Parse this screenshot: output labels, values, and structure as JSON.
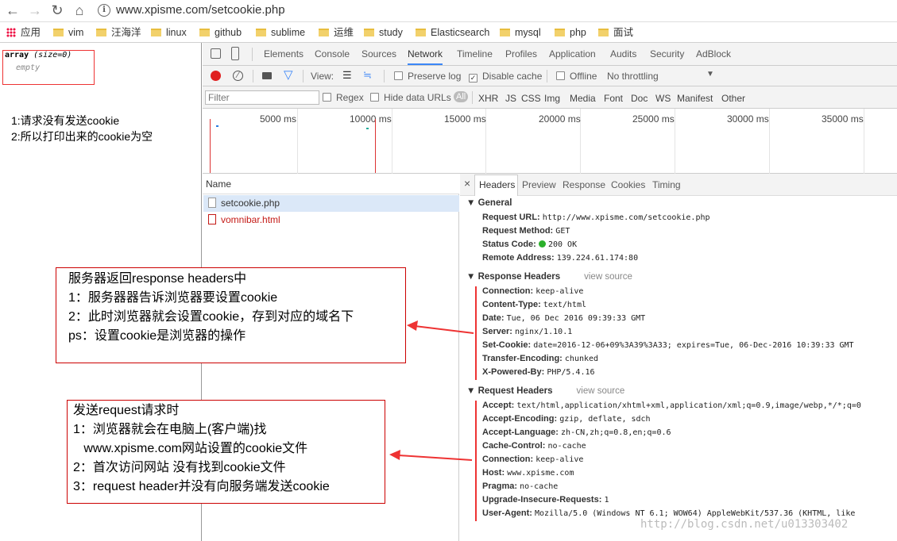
{
  "browser": {
    "url": "www.xpisme.com/setcookie.php",
    "bookmarks": [
      "应用",
      "vim",
      "汪海洋",
      "linux",
      "github",
      "sublime",
      "运维",
      "study",
      "Elasticsearch",
      "mysql",
      "php",
      "面试"
    ]
  },
  "page": {
    "var_dump_type": "array",
    "var_dump_size": "(size=0)",
    "var_dump_empty": "empty",
    "note_line1": "1:请求没有发送cookie",
    "note_line2": "2:所以打印出来的cookie为空"
  },
  "devtools": {
    "tabs": [
      "Elements",
      "Console",
      "Sources",
      "Network",
      "Timeline",
      "Profiles",
      "Application",
      "Audits",
      "Security",
      "AdBlock"
    ],
    "active_tab": "Network",
    "view_label": "View:",
    "preserve_log": "Preserve log",
    "disable_cache": "Disable cache",
    "offline": "Offline",
    "throttling": "No throttling",
    "filter_placeholder": "Filter",
    "regex": "Regex",
    "hide_data_urls": "Hide data URLs",
    "type_filters": [
      "All",
      "XHR",
      "JS",
      "CSS",
      "Img",
      "Media",
      "Font",
      "Doc",
      "WS",
      "Manifest",
      "Other"
    ],
    "timeline_labels": [
      "5000 ms",
      "10000 ms",
      "15000 ms",
      "20000 ms",
      "25000 ms",
      "30000 ms",
      "35000 ms"
    ],
    "name_header": "Name",
    "requests": [
      "setcookie.php",
      "vomnibar.html"
    ],
    "header_tabs": [
      "Headers",
      "Preview",
      "Response",
      "Cookies",
      "Timing"
    ],
    "close": "×"
  },
  "general": {
    "title": "General",
    "items": [
      {
        "k": "Request URL:",
        "v": "http://www.xpisme.com/setcookie.php"
      },
      {
        "k": "Request Method:",
        "v": "GET"
      },
      {
        "k": "Status Code:",
        "v": "200 OK"
      },
      {
        "k": "Remote Address:",
        "v": "139.224.61.174:80"
      }
    ]
  },
  "response_headers": {
    "title": "Response Headers",
    "view_source": "view source",
    "items": [
      {
        "k": "Connection:",
        "v": "keep-alive"
      },
      {
        "k": "Content-Type:",
        "v": "text/html"
      },
      {
        "k": "Date:",
        "v": "Tue, 06 Dec 2016 09:39:33 GMT"
      },
      {
        "k": "Server:",
        "v": "nginx/1.10.1"
      },
      {
        "k": "Set-Cookie:",
        "v": "date=2016-12-06+09%3A39%3A33; expires=Tue, 06-Dec-2016 10:39:33 GMT"
      },
      {
        "k": "Transfer-Encoding:",
        "v": "chunked"
      },
      {
        "k": "X-Powered-By:",
        "v": "PHP/5.4.16"
      }
    ]
  },
  "request_headers": {
    "title": "Request Headers",
    "view_source": "view source",
    "items": [
      {
        "k": "Accept:",
        "v": "text/html,application/xhtml+xml,application/xml;q=0.9,image/webp,*/*;q=0"
      },
      {
        "k": "Accept-Encoding:",
        "v": "gzip, deflate, sdch"
      },
      {
        "k": "Accept-Language:",
        "v": "zh-CN,zh;q=0.8,en;q=0.6"
      },
      {
        "k": "Cache-Control:",
        "v": "no-cache"
      },
      {
        "k": "Connection:",
        "v": "keep-alive"
      },
      {
        "k": "Host:",
        "v": "www.xpisme.com"
      },
      {
        "k": "Pragma:",
        "v": "no-cache"
      },
      {
        "k": "Upgrade-Insecure-Requests:",
        "v": "1"
      },
      {
        "k": "User-Agent:",
        "v": "Mozilla/5.0 (Windows NT 6.1; WOW64) AppleWebKit/537.36 (KHTML, like"
      }
    ]
  },
  "annotation_response": [
    "服务器返回response headers中",
    "1：服务器器告诉浏览器要设置cookie",
    "2：此时浏览器就会设置cookie，存到对应的域名下",
    "ps：设置cookie是浏览器的操作"
  ],
  "annotation_request": [
    "发送request请求时",
    "1：浏览器就会在电脑上(客户端)找",
    "   www.xpisme.com网站设置的cookie文件",
    "2：首次访问网站 没有找到cookie文件",
    "3：request header并没有向服务端发送cookie"
  ],
  "watermark": "http://blog.csdn.net/u013303402",
  "colors": {
    "accent": "#3b86f7",
    "annotation_border": "#c00000",
    "record": "#e02020",
    "error_request": "#c41a16"
  }
}
